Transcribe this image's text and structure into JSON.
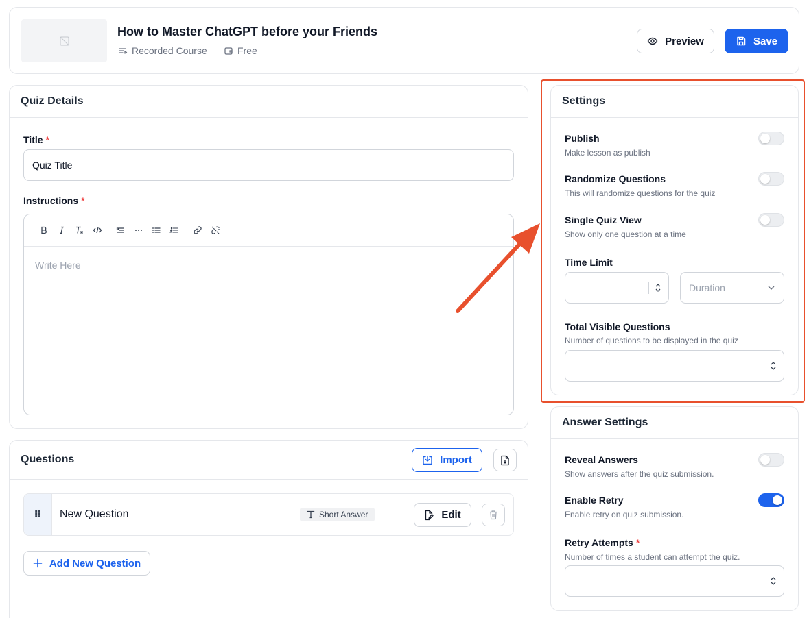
{
  "course": {
    "title": "How to Master ChatGPT before your Friends",
    "type_label": "Recorded Course",
    "price_label": "Free",
    "preview_label": "Preview",
    "save_label": "Save"
  },
  "quiz_details": {
    "heading": "Quiz Details",
    "title_label": "Title",
    "title_value": "Quiz Title",
    "instructions_label": "Instructions",
    "required_mark": "*",
    "editor_placeholder": "Write Here",
    "toolbar_icons": [
      "bold-icon",
      "italic-icon",
      "clear-format-icon",
      "code-icon",
      "blockquote-icon",
      "more-icon",
      "bullet-list-icon",
      "numbered-list-icon",
      "link-icon",
      "unlink-icon"
    ]
  },
  "questions": {
    "heading": "Questions",
    "import_label": "Import",
    "items": [
      {
        "name": "New Question",
        "type": "Short Answer",
        "edit_label": "Edit"
      }
    ],
    "add_label": "Add New Question"
  },
  "settings": {
    "heading": "Settings",
    "publish": {
      "title": "Publish",
      "desc": "Make lesson as publish",
      "on": false
    },
    "randomize": {
      "title": "Randomize Questions",
      "desc": "This will randomize questions for the quiz",
      "on": false
    },
    "single_view": {
      "title": "Single Quiz View",
      "desc": "Show only one question at a time",
      "on": false
    },
    "time_limit": {
      "title": "Time Limit",
      "duration_placeholder": "Duration"
    },
    "visible_questions": {
      "title": "Total Visible Questions",
      "desc": "Number of questions to be displayed in the quiz"
    }
  },
  "answer_settings": {
    "heading": "Answer Settings",
    "reveal": {
      "title": "Reveal Answers",
      "desc": "Show answers after the quiz submission.",
      "on": false
    },
    "retry": {
      "title": "Enable Retry",
      "desc": "Enable retry on quiz submission.",
      "on": true
    },
    "attempts": {
      "title": "Retry Attempts",
      "desc": "Number of times a student can attempt the quiz."
    }
  },
  "colors": {
    "primary": "#1d63ed",
    "highlight": "#e8502d",
    "required": "#ef4444"
  }
}
